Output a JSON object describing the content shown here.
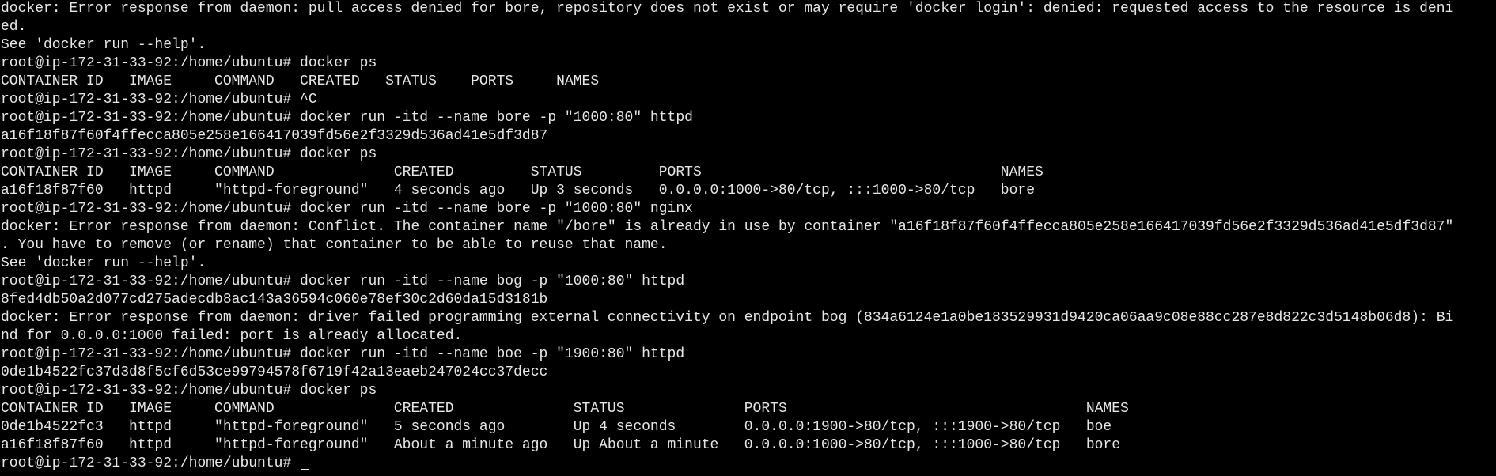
{
  "terminal": {
    "lines": [
      "docker: Error response from daemon: pull access denied for bore, repository does not exist or may require 'docker login': denied: requested access to the resource is deni",
      "ed.",
      "See 'docker run --help'.",
      "root@ip-172-31-33-92:/home/ubuntu# docker ps",
      "CONTAINER ID   IMAGE     COMMAND   CREATED   STATUS    PORTS     NAMES",
      "root@ip-172-31-33-92:/home/ubuntu# ^C",
      "root@ip-172-31-33-92:/home/ubuntu# docker run -itd --name bore -p \"1000:80\" httpd",
      "a16f18f87f60f4ffecca805e258e166417039fd56e2f3329d536ad41e5df3d87",
      "root@ip-172-31-33-92:/home/ubuntu# docker ps",
      "CONTAINER ID   IMAGE     COMMAND              CREATED         STATUS         PORTS                                   NAMES",
      "a16f18f87f60   httpd     \"httpd-foreground\"   4 seconds ago   Up 3 seconds   0.0.0.0:1000->80/tcp, :::1000->80/tcp   bore",
      "root@ip-172-31-33-92:/home/ubuntu# docker run -itd --name bore -p \"1000:80\" nginx",
      "docker: Error response from daemon: Conflict. The container name \"/bore\" is already in use by container \"a16f18f87f60f4ffecca805e258e166417039fd56e2f3329d536ad41e5df3d87\"",
      ". You have to remove (or rename) that container to be able to reuse that name.",
      "See 'docker run --help'.",
      "root@ip-172-31-33-92:/home/ubuntu# docker run -itd --name bog -p \"1000:80\" httpd",
      "8fed4db50a2d077cd275adecdb8ac143a36594c060e78ef30c2d60da15d3181b",
      "docker: Error response from daemon: driver failed programming external connectivity on endpoint bog (834a6124e1a0be183529931d9420ca06aa9c08e88cc287e8d822c3d5148b06d8): Bi",
      "nd for 0.0.0.0:1000 failed: port is already allocated.",
      "root@ip-172-31-33-92:/home/ubuntu# docker run -itd --name boe -p \"1900:80\" httpd",
      "0de1b4522fc37d3d8f5cf6d53ce99794578f6719f42a13eaeb247024cc37decc",
      "root@ip-172-31-33-92:/home/ubuntu# docker ps",
      "CONTAINER ID   IMAGE     COMMAND              CREATED              STATUS              PORTS                                   NAMES",
      "0de1b4522fc3   httpd     \"httpd-foreground\"   5 seconds ago        Up 4 seconds        0.0.0.0:1900->80/tcp, :::1900->80/tcp   boe",
      "a16f18f87f60   httpd     \"httpd-foreground\"   About a minute ago   Up About a minute   0.0.0.0:1000->80/tcp, :::1000->80/tcp   bore"
    ],
    "prompt": "root@ip-172-31-33-92:/home/ubuntu# "
  }
}
